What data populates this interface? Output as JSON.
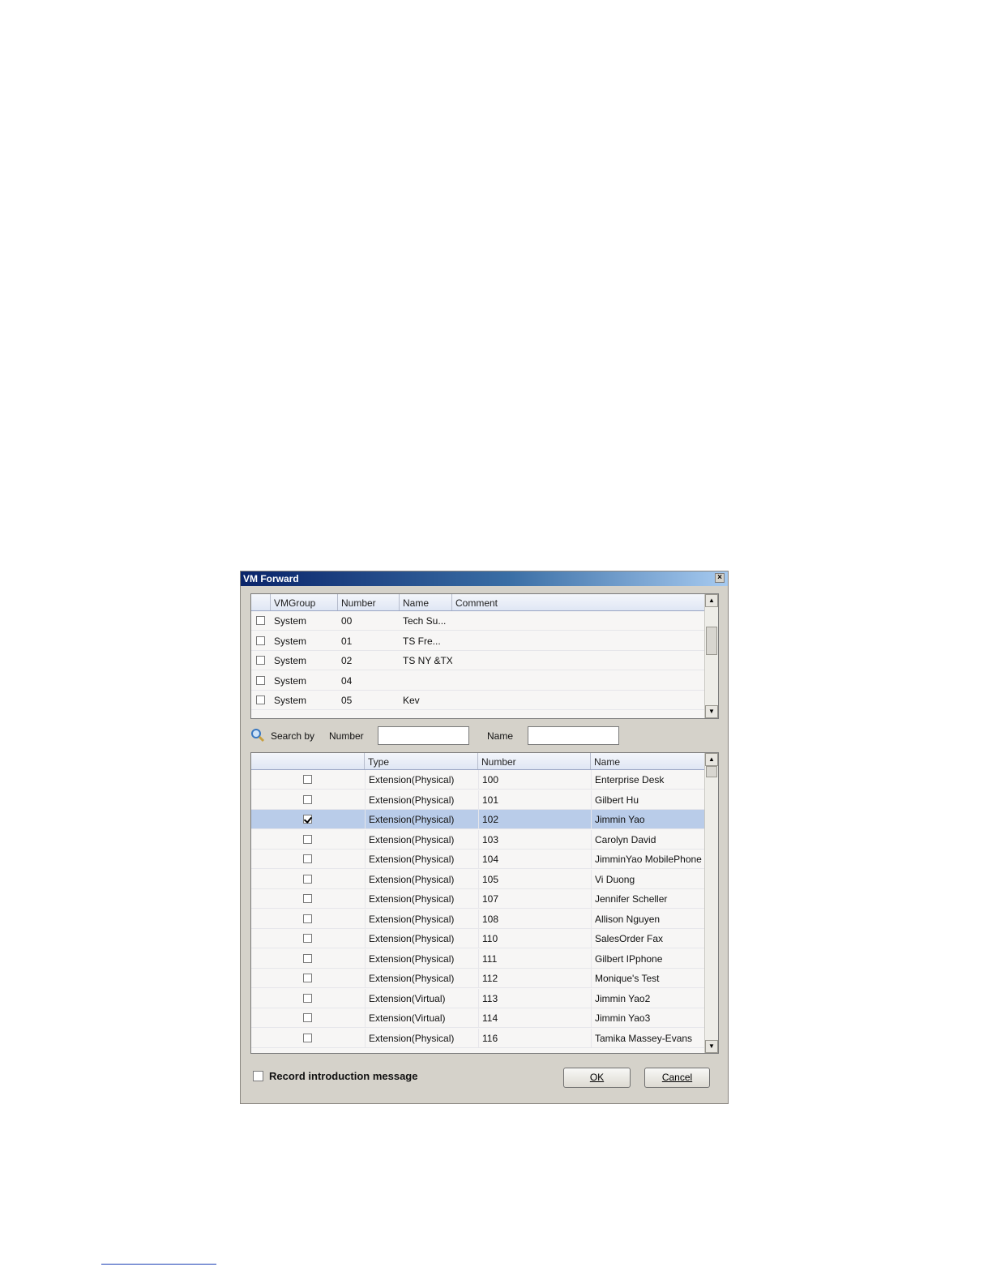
{
  "window": {
    "title": "VM Forward",
    "close_glyph": "×"
  },
  "vmgroup_grid": {
    "headers": [
      "VMGroup",
      "Number",
      "Name",
      "Comment"
    ],
    "rows": [
      {
        "group": "System",
        "number": "00",
        "name": "Tech Su...",
        "comment": ""
      },
      {
        "group": "System",
        "number": "01",
        "name": "TS Fre...",
        "comment": ""
      },
      {
        "group": "System",
        "number": "02",
        "name": "TS NY &TX",
        "comment": ""
      },
      {
        "group": "System",
        "number": "04",
        "name": "",
        "comment": ""
      },
      {
        "group": "System",
        "number": "05",
        "name": "Kev",
        "comment": ""
      }
    ]
  },
  "search": {
    "label": "Search by",
    "number_label": "Number",
    "name_label": "Name",
    "number_value": "",
    "name_value": ""
  },
  "extension_grid": {
    "headers": [
      "",
      "Type",
      "Number",
      "Name"
    ],
    "rows": [
      {
        "checked": false,
        "type": "Extension(Physical)",
        "number": "100",
        "name": "Enterprise Desk"
      },
      {
        "checked": false,
        "type": "Extension(Physical)",
        "number": "101",
        "name": "Gilbert Hu"
      },
      {
        "checked": true,
        "type": "Extension(Physical)",
        "number": "102",
        "name": "Jimmin Yao"
      },
      {
        "checked": false,
        "type": "Extension(Physical)",
        "number": "103",
        "name": "Carolyn David"
      },
      {
        "checked": false,
        "type": "Extension(Physical)",
        "number": "104",
        "name": "JimminYao MobilePhone"
      },
      {
        "checked": false,
        "type": "Extension(Physical)",
        "number": "105",
        "name": "Vi Duong"
      },
      {
        "checked": false,
        "type": "Extension(Physical)",
        "number": "107",
        "name": "Jennifer Scheller"
      },
      {
        "checked": false,
        "type": "Extension(Physical)",
        "number": "108",
        "name": "Allison Nguyen"
      },
      {
        "checked": false,
        "type": "Extension(Physical)",
        "number": "110",
        "name": "SalesOrder Fax"
      },
      {
        "checked": false,
        "type": "Extension(Physical)",
        "number": "111",
        "name": "Gilbert IPphone"
      },
      {
        "checked": false,
        "type": "Extension(Physical)",
        "number": "112",
        "name": "Monique's Test"
      },
      {
        "checked": false,
        "type": "Extension(Virtual)",
        "number": "113",
        "name": "Jimmin Yao2"
      },
      {
        "checked": false,
        "type": "Extension(Virtual)",
        "number": "114",
        "name": "Jimmin Yao3"
      },
      {
        "checked": false,
        "type": "Extension(Physical)",
        "number": "116",
        "name": "Tamika Massey-Evans"
      }
    ]
  },
  "footer": {
    "record_label": "Record introduction message",
    "record_checked": false,
    "ok_label": "OK",
    "cancel_label": "Cancel"
  },
  "icons": {
    "search": "search-icon",
    "scroll_up": "▲",
    "scroll_down": "▼"
  },
  "colors": {
    "title_start": "#0a246a",
    "title_end": "#a6caf0",
    "selected_row": "#b9cce9",
    "dialog_bg": "#d5d2ca"
  }
}
